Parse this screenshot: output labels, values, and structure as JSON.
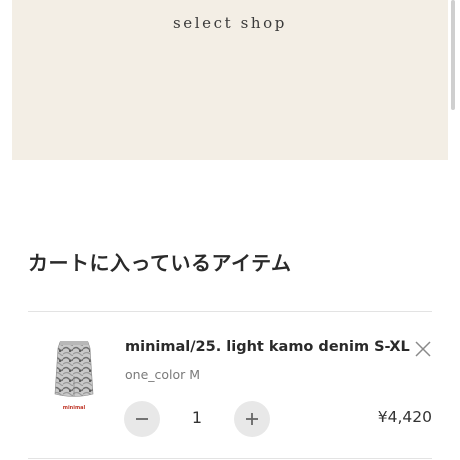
{
  "header": {
    "banner_title": "select shop"
  },
  "cart": {
    "heading": "カートに入っているアイテム",
    "items": [
      {
        "name": "minimal/25. light kamo denim S-XL",
        "variant": "one_color M",
        "quantity": "1",
        "price": "¥4,420",
        "thumbnail_brand": "minimal",
        "thumbnail_icon": "camo-skirt-product-image"
      }
    ],
    "remove_icon": "close-icon",
    "decrease_icon": "minus-icon",
    "increase_icon": "plus-icon"
  },
  "colors": {
    "banner_bg": "#f3eee5",
    "text": "#2a2a2a",
    "muted_text": "#7a7a7a",
    "qty_button_bg": "#e8e8e8",
    "divider": "#e3e3e3",
    "brand_red": "#c0392b"
  }
}
